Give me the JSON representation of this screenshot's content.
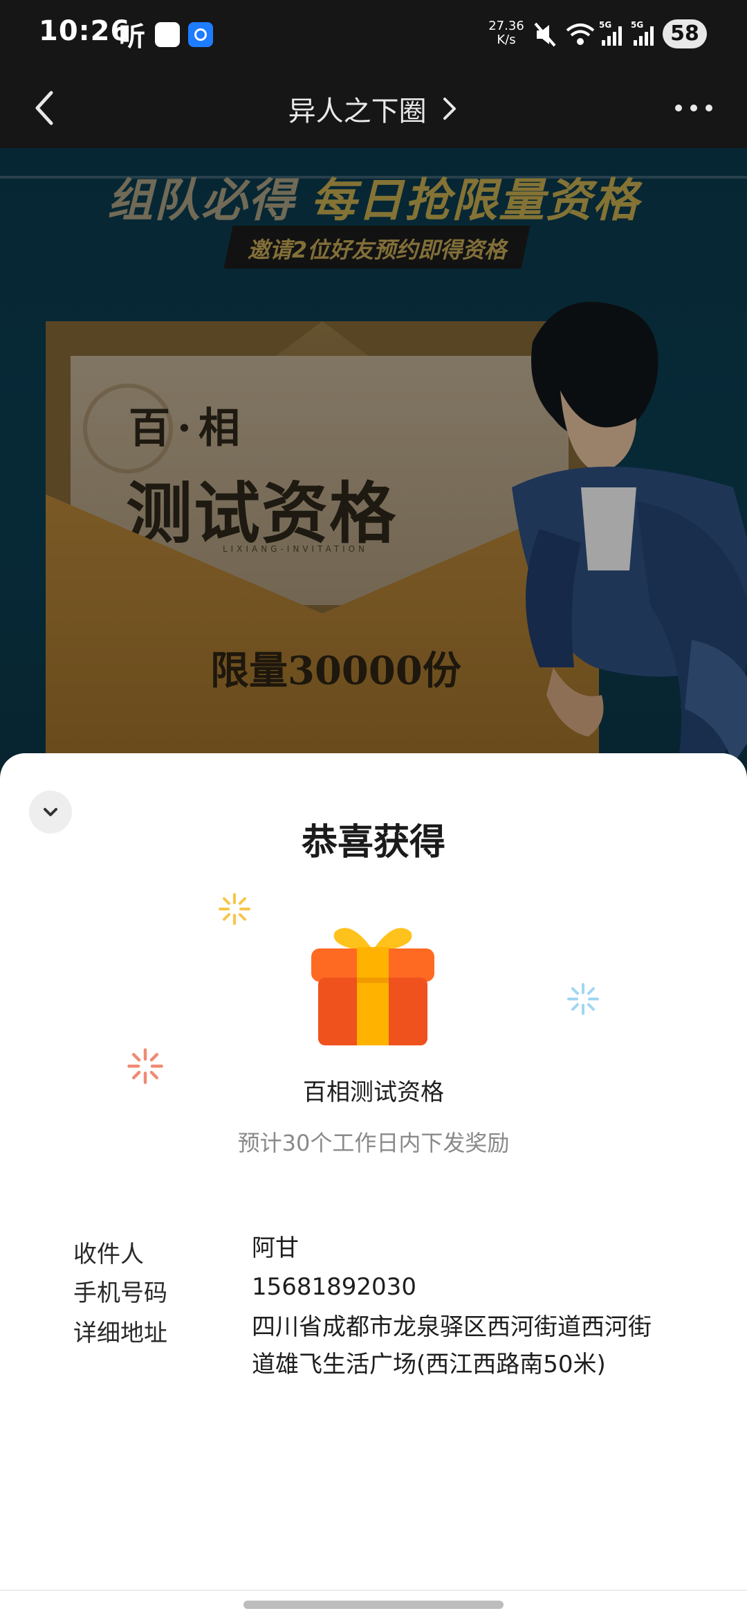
{
  "status_bar": {
    "time": "10:26",
    "app_label": "听",
    "net_speed_value": "27.36",
    "net_speed_unit": "K/s",
    "battery": "58",
    "icons": [
      "mute-icon",
      "wifi-icon",
      "signal-5g-icon",
      "signal-5g-icon",
      "battery-icon"
    ]
  },
  "nav": {
    "title": "异人之下圈"
  },
  "banner": {
    "headline_part1": "组队必得",
    "headline_part2": "每日抢限量资格",
    "subheadline": "邀请2位好友预约即得资格",
    "letter_line1": "百·相",
    "letter_line2": "测试资格",
    "letter_small": "LIXIANG-INVITATION",
    "limit_text": "限量30000份"
  },
  "sheet": {
    "title": "恭喜获得",
    "prize_name": "百相测试资格",
    "prize_note": "预计30个工作日内下发奖励",
    "recipient_label": "收件人",
    "recipient_value": "阿甘",
    "phone_label": "手机号码",
    "phone_value": "15681892030",
    "address_label": "详细地址",
    "address_value": "四川省成都市龙泉驿区西河街道西河街道雄飞生活广场(西江西路南50米)"
  },
  "colors": {
    "gift_body": "#f0521e",
    "gift_ribbon": "#ffb300",
    "sparkle_yellow": "#f6c64a",
    "sparkle_blue": "#9fd6f2",
    "sparkle_red": "#f08a74"
  }
}
